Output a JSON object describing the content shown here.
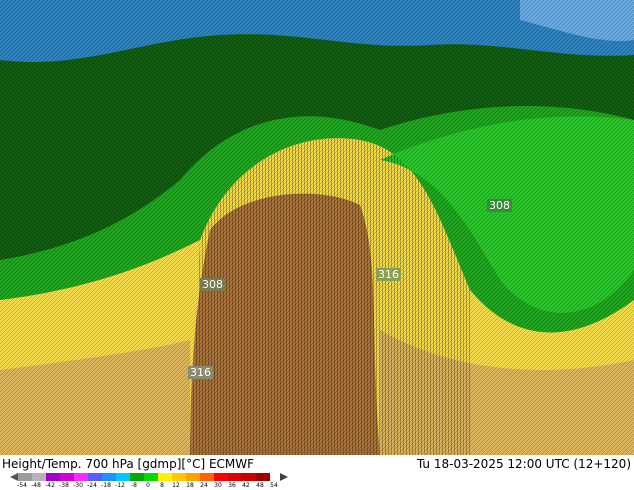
{
  "footer": {
    "title": "Height/Temp. 700 hPa [gdmp][°C] ECMWF",
    "valid_time": "Tu 18-03-2025 12:00 UTC (12+120)"
  },
  "contour_labels": [
    "308",
    "308",
    "316",
    "316"
  ],
  "colorbar": {
    "ticks": [
      "-54",
      "-48",
      "-42",
      "-38",
      "-30",
      "-24",
      "-18",
      "-12",
      "-8",
      "0",
      "8",
      "12",
      "18",
      "24",
      "30",
      "36",
      "42",
      "48",
      "54"
    ],
    "colors": [
      "#9b9b9b",
      "#b4b4b4",
      "#a000c8",
      "#d300d3",
      "#ff28ff",
      "#5a5aff",
      "#1e90ff",
      "#00c8ff",
      "#00aa00",
      "#00dc00",
      "#fff000",
      "#ffc800",
      "#ffa000",
      "#ff6400",
      "#ff0000",
      "#dc0000",
      "#c80000",
      "#a00000"
    ]
  },
  "colors": {
    "dark_green": "#0d4a0d",
    "mid_green": "#1f7a1f",
    "bright_green": "#22b422",
    "yellow": "#f0e040",
    "tan": "#d2a85a",
    "brown": "#8b5a2b",
    "blue": "#4f8fd0"
  }
}
